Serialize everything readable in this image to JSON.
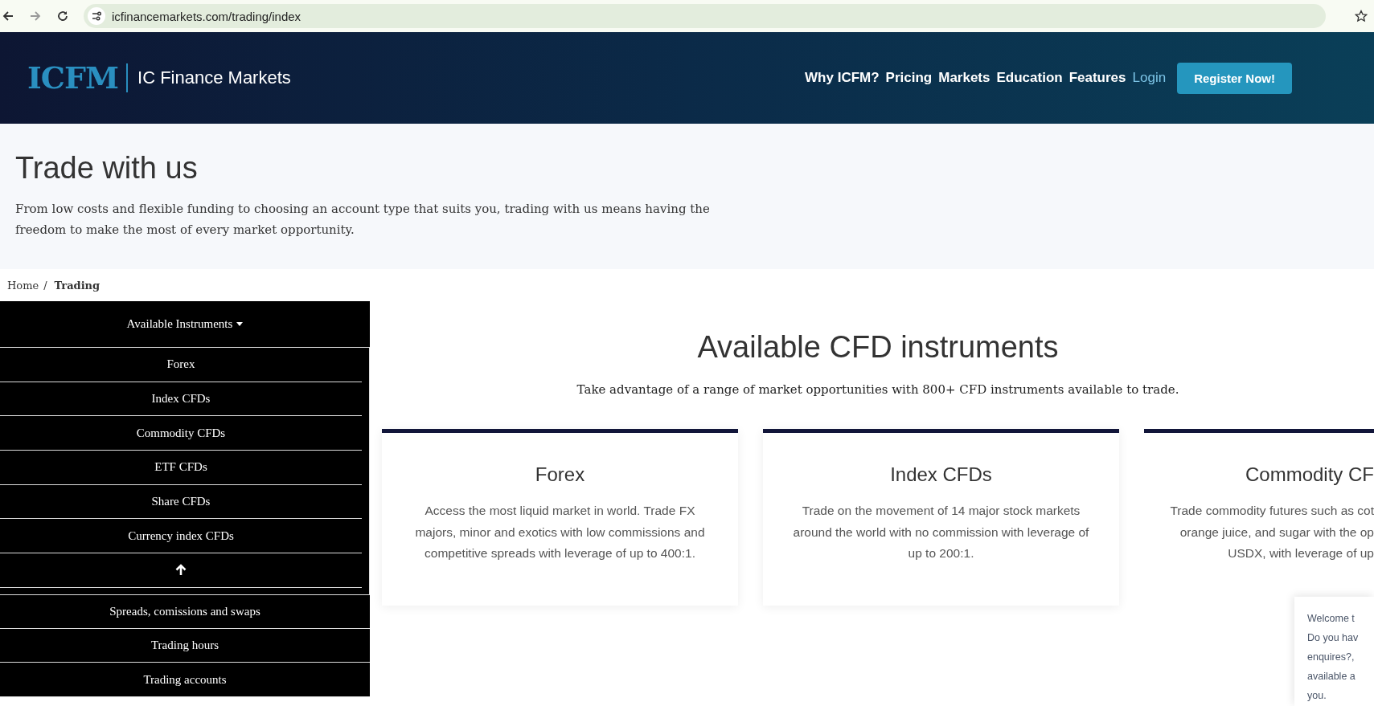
{
  "browser": {
    "url": "icfinancemarkets.com/trading/index",
    "back_disabled": false,
    "forward_disabled": true
  },
  "header": {
    "logo": "ICFM",
    "brand": "IC Finance Markets",
    "nav": [
      {
        "label": "Why ICFM?",
        "kind": "link"
      },
      {
        "label": "Pricing",
        "kind": "link"
      },
      {
        "label": "Markets",
        "kind": "link"
      },
      {
        "label": "Education",
        "kind": "link"
      },
      {
        "label": "Features",
        "kind": "link"
      },
      {
        "label": "Login",
        "kind": "login"
      },
      {
        "label": "Register Now!",
        "kind": "button"
      }
    ]
  },
  "hero": {
    "title": "Trade with us",
    "text": "From low costs and flexible funding to choosing an account type that suits you, trading with us means having the freedom to make the most of every market opportunity."
  },
  "breadcrumb": [
    {
      "label": "Home",
      "current": false,
      "separator": "/"
    },
    {
      "label": "Trading",
      "current": true
    }
  ],
  "sidebar": {
    "dropdown": {
      "label": "Available Instruments",
      "expanded": true,
      "items": [
        {
          "label": "Forex",
          "kind": "link"
        },
        {
          "label": "Index CFDs",
          "kind": "link"
        },
        {
          "label": "Commodity CFDs",
          "kind": "link"
        },
        {
          "label": "ETF CFDs",
          "kind": "link"
        },
        {
          "label": "Share CFDs",
          "kind": "link"
        },
        {
          "label": "Currency index CFDs",
          "kind": "link"
        },
        {
          "kind": "up"
        }
      ]
    },
    "items": [
      {
        "label": "Spreads, comissions and swaps"
      },
      {
        "label": "Trading hours"
      },
      {
        "label": "Trading accounts"
      }
    ]
  },
  "main": {
    "title": "Available CFD instruments",
    "subtitle": "Take advantage of a range of market opportunities with 800+ CFD instruments available to trade.",
    "cards": [
      {
        "title": "Forex",
        "kind": "full",
        "lines": [
          "Access the most liquid market in world. Trade FX",
          "majors, minor and exotics with low commissions and",
          "competitive spreads with leverage of up to 400:1."
        ]
      },
      {
        "title": "Index CFDs",
        "kind": "full",
        "lines": [
          "Trade on the movement of 14 major stock markets",
          "around the world with no commission with leverage of",
          "up to 200:1."
        ]
      },
      {
        "title": "Commodity CF",
        "kind": "cut",
        "lines": [
          "Trade commodity futures such as cot",
          "orange juice, and sugar with the op",
          "USDX, with leverage of up"
        ]
      }
    ]
  },
  "chat": {
    "lines": [
      "Welcome t",
      "Do you hav",
      "enquires?,",
      "available a",
      "you."
    ]
  }
}
